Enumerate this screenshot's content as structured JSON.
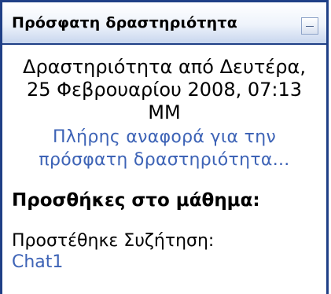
{
  "block": {
    "title": "Πρόσφατη δραστηριότητα",
    "hide_icon": "minus-box-icon",
    "activity_since": "Δραστηριότητα από Δευτέρα,\n25 Φεβρουαρίου 2008, 07:13\nΜΜ",
    "full_report_link": "Πλήρης αναφορά για την πρόσφατη δραστηριότητα...",
    "added_section_title": "Προσθήκες στο μάθημα:",
    "added_item_label": "Προστέθηκε Συζήτηση:",
    "added_item_link": "Chat1"
  },
  "colors": {
    "border": "#1f3f86",
    "link": "#3d63b6"
  }
}
